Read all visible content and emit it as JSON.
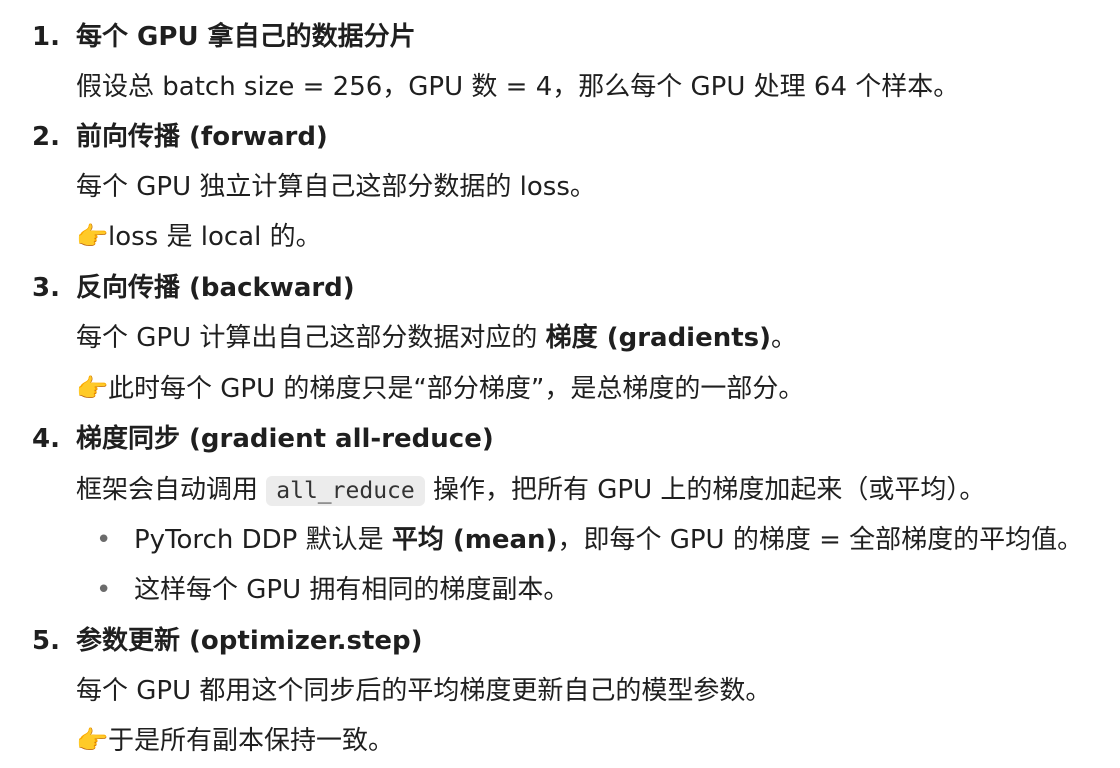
{
  "steps": [
    {
      "num": "1.",
      "title": "每个 GPU 拿自己的数据分片",
      "para": "假设总 batch size = 256，GPU 数 = 4，那么每个 GPU 处理 64 个样本。"
    },
    {
      "num": "2.",
      "title": "前向传播 (forward)",
      "para": "每个 GPU 独立计算自己这部分数据的 loss。",
      "note": "loss 是 local 的。"
    },
    {
      "num": "3.",
      "title": "反向传播 (backward)",
      "para_pre": "每个 GPU 计算出自己这部分数据对应的 ",
      "para_bold": "梯度 (gradients)",
      "para_post": "。",
      "note": "此时每个 GPU 的梯度只是“部分梯度”，是总梯度的一部分。"
    },
    {
      "num": "4.",
      "title": "梯度同步 (gradient all-reduce)",
      "para_pre": "框架会自动调用 ",
      "code": "all_reduce",
      "para_post": " 操作，把所有 GPU 上的梯度加起来（或平均）。",
      "bullets": [
        {
          "pre": "PyTorch DDP 默认是 ",
          "bold": "平均 (mean)",
          "post": "，即每个 GPU 的梯度 = 全部梯度的平均值。"
        },
        {
          "pre": "这样每个 GPU 拥有相同的梯度副本。",
          "bold": "",
          "post": ""
        }
      ]
    },
    {
      "num": "5.",
      "title": "参数更新 (optimizer.step)",
      "para": "每个 GPU 都用这个同步后的平均梯度更新自己的模型参数。",
      "note": "于是所有副本保持一致。"
    }
  ],
  "icons": {
    "note_icon": "backhand-index-pointing-right"
  }
}
